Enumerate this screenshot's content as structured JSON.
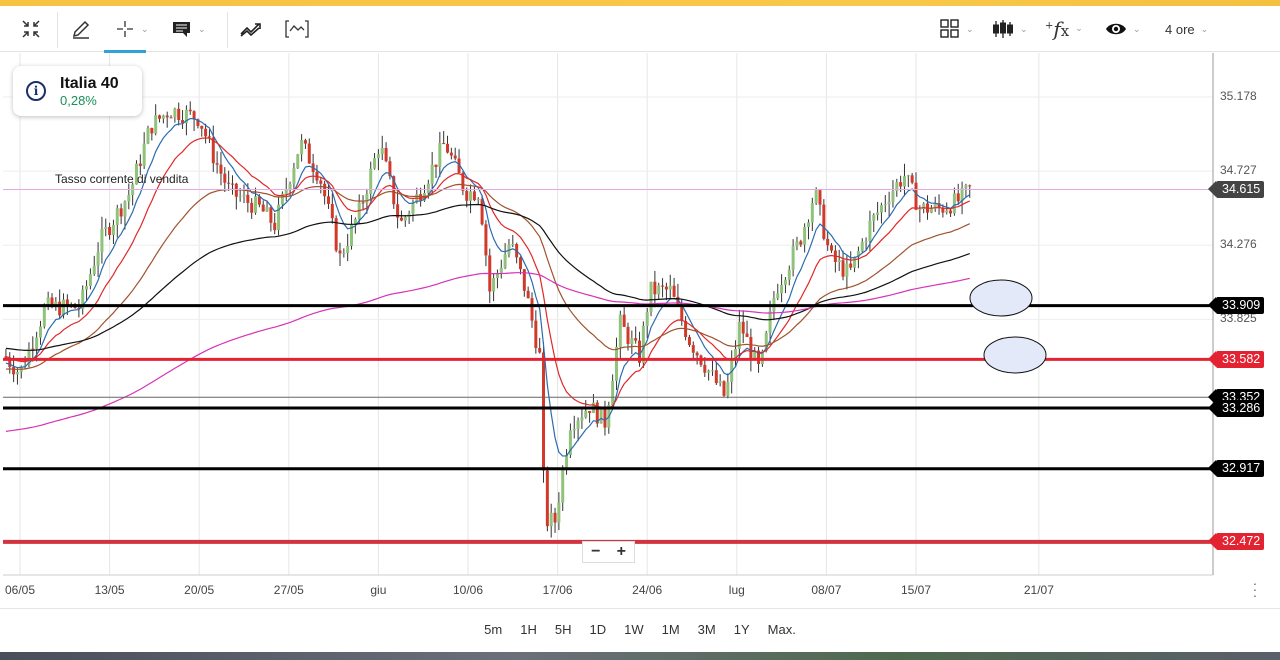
{
  "toolbar": {
    "timeframe": "4 ore",
    "icons": [
      "collapse-icon",
      "pencil-icon",
      "crosshair-icon",
      "comment-icon",
      "trend-icon",
      "indicator-chart-icon",
      "layout-grid-icon",
      "candlestick-icon",
      "fx-icon",
      "eye-icon"
    ]
  },
  "instrument": {
    "name": "Italia 40",
    "change": "0,28%"
  },
  "annotation": "Tasso corrente di vendita",
  "price_axis": {
    "ticks": [
      "35.178",
      "34.727",
      "34.276",
      "33.825"
    ]
  },
  "levels": [
    {
      "label": "34.615",
      "value": 34.615,
      "color": "#444444",
      "line": "#e6a8e6",
      "width": 1
    },
    {
      "label": "33.909",
      "value": 33.909,
      "color": "#000000",
      "line": "#000000",
      "width": 3
    },
    {
      "label": "33.582",
      "value": 33.582,
      "color": "#e32232",
      "line": "#e32232",
      "width": 3
    },
    {
      "label": "33.352",
      "value": 33.352,
      "color": "#000000",
      "line": "#666666",
      "width": 1
    },
    {
      "label": "33.286",
      "value": 33.286,
      "color": "#000000",
      "line": "#000000",
      "width": 3
    },
    {
      "label": "32.917",
      "value": 32.917,
      "color": "#000000",
      "line": "#000000",
      "width": 3
    },
    {
      "label": "32.472",
      "value": 32.472,
      "color": "#e32232",
      "line": "#d1333f",
      "width": 4
    }
  ],
  "x_axis": {
    "labels": [
      {
        "t": "06/05",
        "day": 0
      },
      {
        "t": "13/05",
        "day": 7
      },
      {
        "t": "20/05",
        "day": 14
      },
      {
        "t": "27/05",
        "day": 21
      },
      {
        "t": "giu",
        "day": 28
      },
      {
        "t": "10/06",
        "day": 35
      },
      {
        "t": "17/06",
        "day": 42
      },
      {
        "t": "24/06",
        "day": 49
      },
      {
        "t": "lug",
        "day": 56
      },
      {
        "t": "08/07",
        "day": 63
      },
      {
        "t": "15/07",
        "day": 70
      },
      {
        "t": "21/07",
        "day": 79.6
      }
    ]
  },
  "chart_data": {
    "type": "candlestick",
    "ylim": [
      32.2,
      35.45
    ],
    "path": [
      [
        -1.2,
        33.6
      ],
      [
        0,
        33.5
      ],
      [
        2,
        33.9
      ],
      [
        4.7,
        33.9
      ],
      [
        6.25,
        34.3
      ],
      [
        8.6,
        34.6
      ],
      [
        10.2,
        35.0
      ],
      [
        11.7,
        35.1
      ],
      [
        14,
        35.05
      ],
      [
        15.2,
        34.8
      ],
      [
        16.4,
        34.6
      ],
      [
        18.75,
        34.5
      ],
      [
        19.9,
        34.4
      ],
      [
        21.9,
        34.9
      ],
      [
        23.4,
        34.7
      ],
      [
        25,
        34.2
      ],
      [
        26.6,
        34.5
      ],
      [
        28.1,
        34.9
      ],
      [
        29.7,
        34.4
      ],
      [
        31.25,
        34.6
      ],
      [
        33.2,
        34.9
      ],
      [
        34.8,
        34.6
      ],
      [
        35.9,
        34.6
      ],
      [
        36.7,
        34.0
      ],
      [
        38.3,
        34.3
      ],
      [
        39.5,
        34.0
      ],
      [
        40.6,
        33.6
      ],
      [
        41,
        32.6
      ],
      [
        41.8,
        32.6
      ],
      [
        43,
        33.2
      ],
      [
        44.5,
        33.3
      ],
      [
        45.7,
        33.2
      ],
      [
        46.9,
        33.8
      ],
      [
        48.4,
        33.6
      ],
      [
        49.2,
        34.0
      ],
      [
        50.8,
        34.0
      ],
      [
        52.3,
        33.7
      ],
      [
        53.9,
        33.5
      ],
      [
        55.1,
        33.35
      ],
      [
        56.25,
        33.8
      ],
      [
        57.8,
        33.5
      ],
      [
        59,
        34.0
      ],
      [
        60.9,
        34.3
      ],
      [
        62.1,
        34.6
      ],
      [
        63.3,
        34.2
      ],
      [
        64.8,
        34.1
      ],
      [
        66.4,
        34.4
      ],
      [
        68,
        34.6
      ],
      [
        69.1,
        34.7
      ],
      [
        70.3,
        34.5
      ],
      [
        71.9,
        34.5
      ],
      [
        73.4,
        34.55
      ],
      [
        74.2,
        34.615
      ]
    ],
    "moving_averages": [
      {
        "period": 8,
        "color": "#2b6cb0",
        "start": 33.55
      },
      {
        "period": 18,
        "color": "#e02828",
        "start": 33.6
      },
      {
        "period": 45,
        "color": "#a0522d",
        "start": 33.52
      },
      {
        "period": 100,
        "color": "#111111",
        "start": 33.65
      },
      {
        "period": 220,
        "color": "#d633b8",
        "start": 33.14
      }
    ],
    "colors": {
      "up": "#8fc27a",
      "down": "#d13a2a"
    }
  },
  "zoom": {
    "minus": "−",
    "plus": "+"
  },
  "timeframes": [
    "5m",
    "1H",
    "5H",
    "1D",
    "1W",
    "1M",
    "3M",
    "1Y",
    "Max."
  ]
}
